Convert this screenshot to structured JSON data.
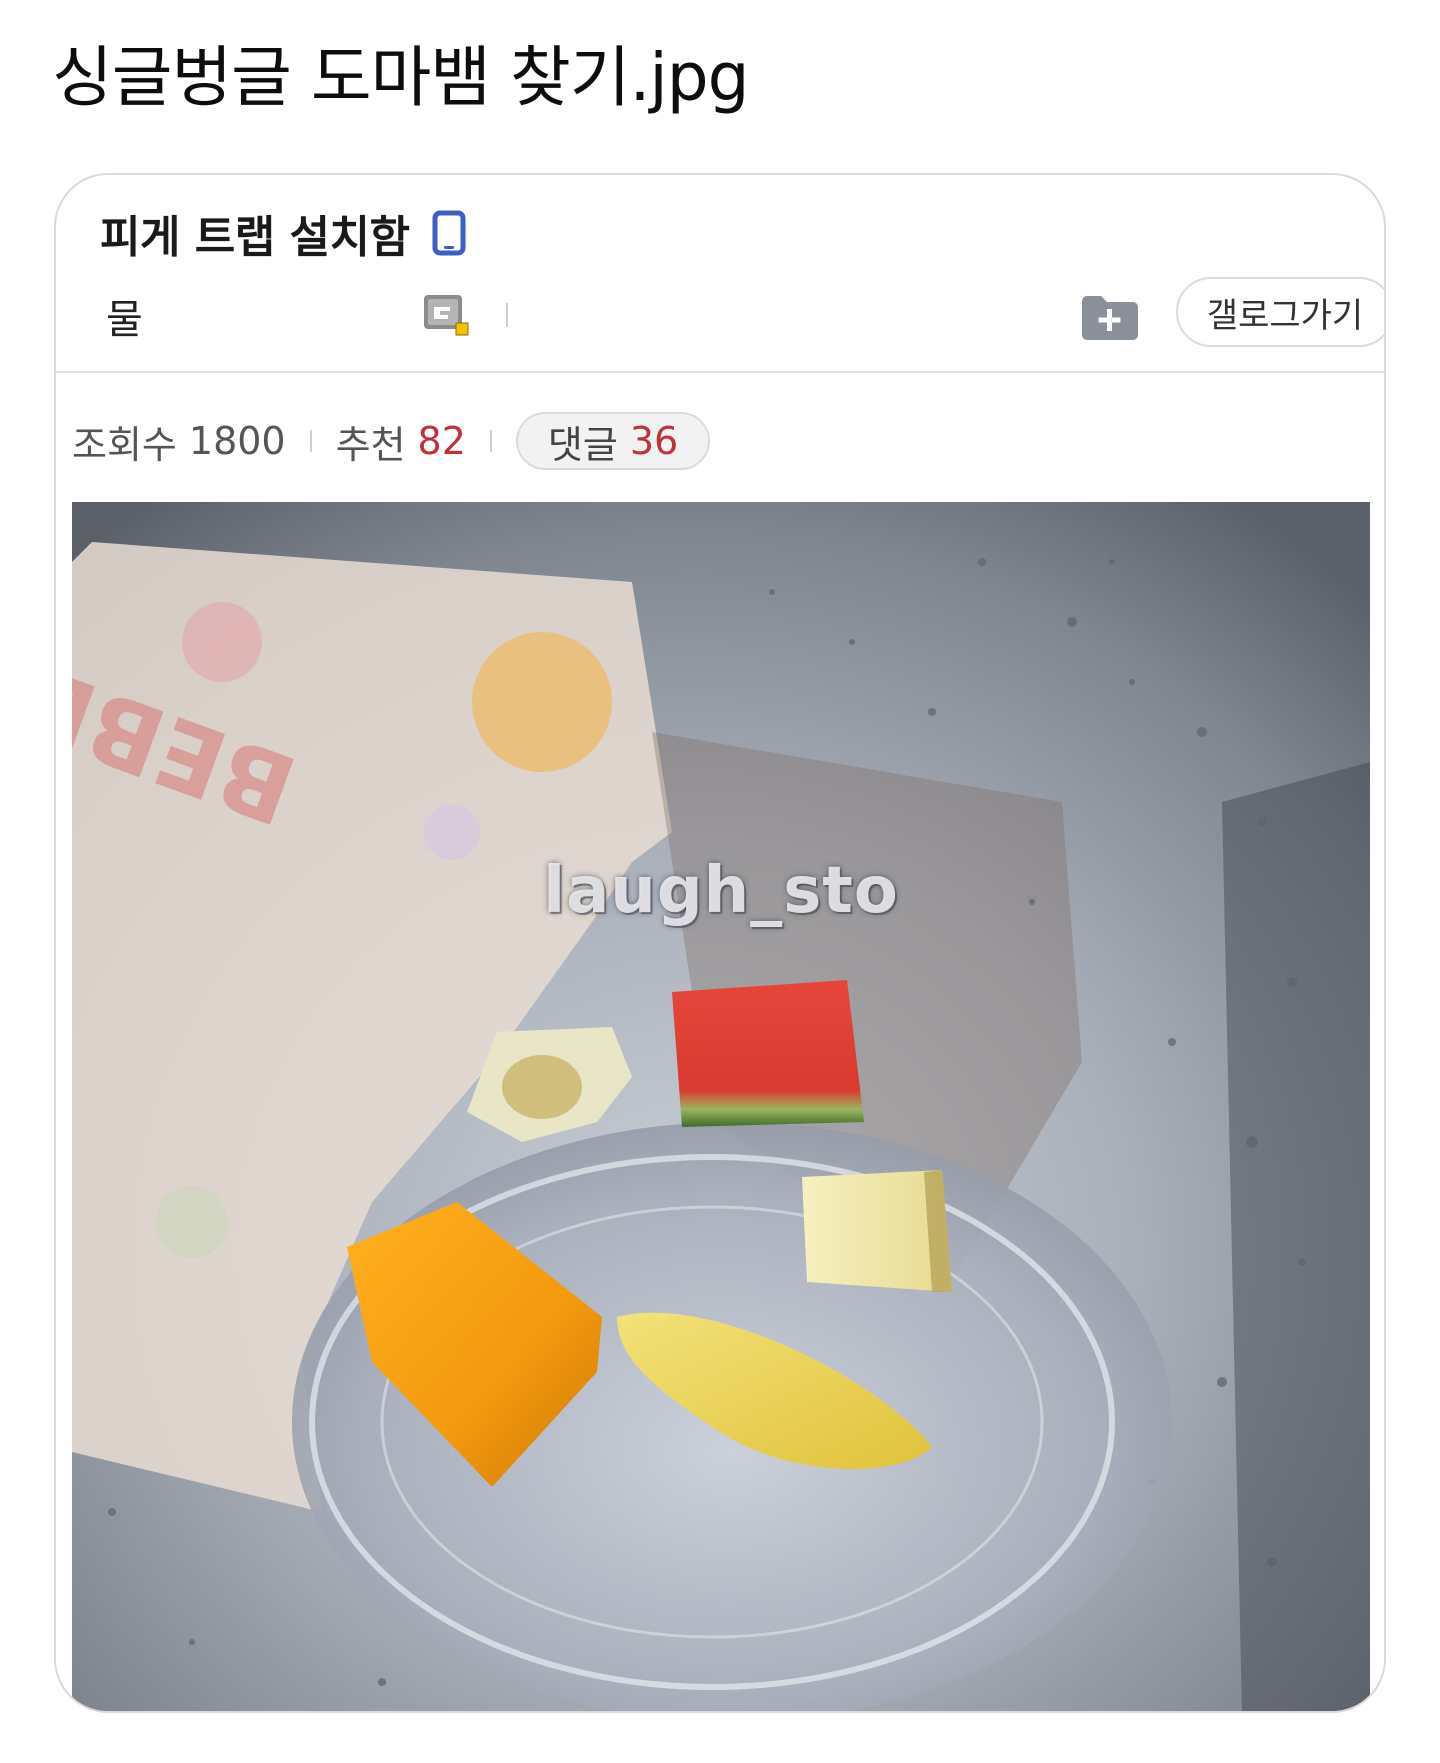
{
  "page": {
    "title": "싱글벙글 도마뱀 찾기.jpg"
  },
  "post": {
    "title": "피게 트랩 설치함",
    "author": "물",
    "gallog_label": "갤로그가기",
    "stats": {
      "views_label": "조회수",
      "views": "1800",
      "recommend_label": "추천",
      "recommend": "82",
      "comments_label": "댓글",
      "comments": "36"
    },
    "image": {
      "watermark": "laugh_sto",
      "bag_text": "BEBETO"
    }
  },
  "icons": {
    "device": "phone-icon",
    "badge": "user-badge-icon",
    "folder": "folder-add-icon"
  },
  "colors": {
    "accent_red": "#c0313a",
    "icon_blue": "#3b5ec9",
    "folder_gray": "#8a909a"
  }
}
